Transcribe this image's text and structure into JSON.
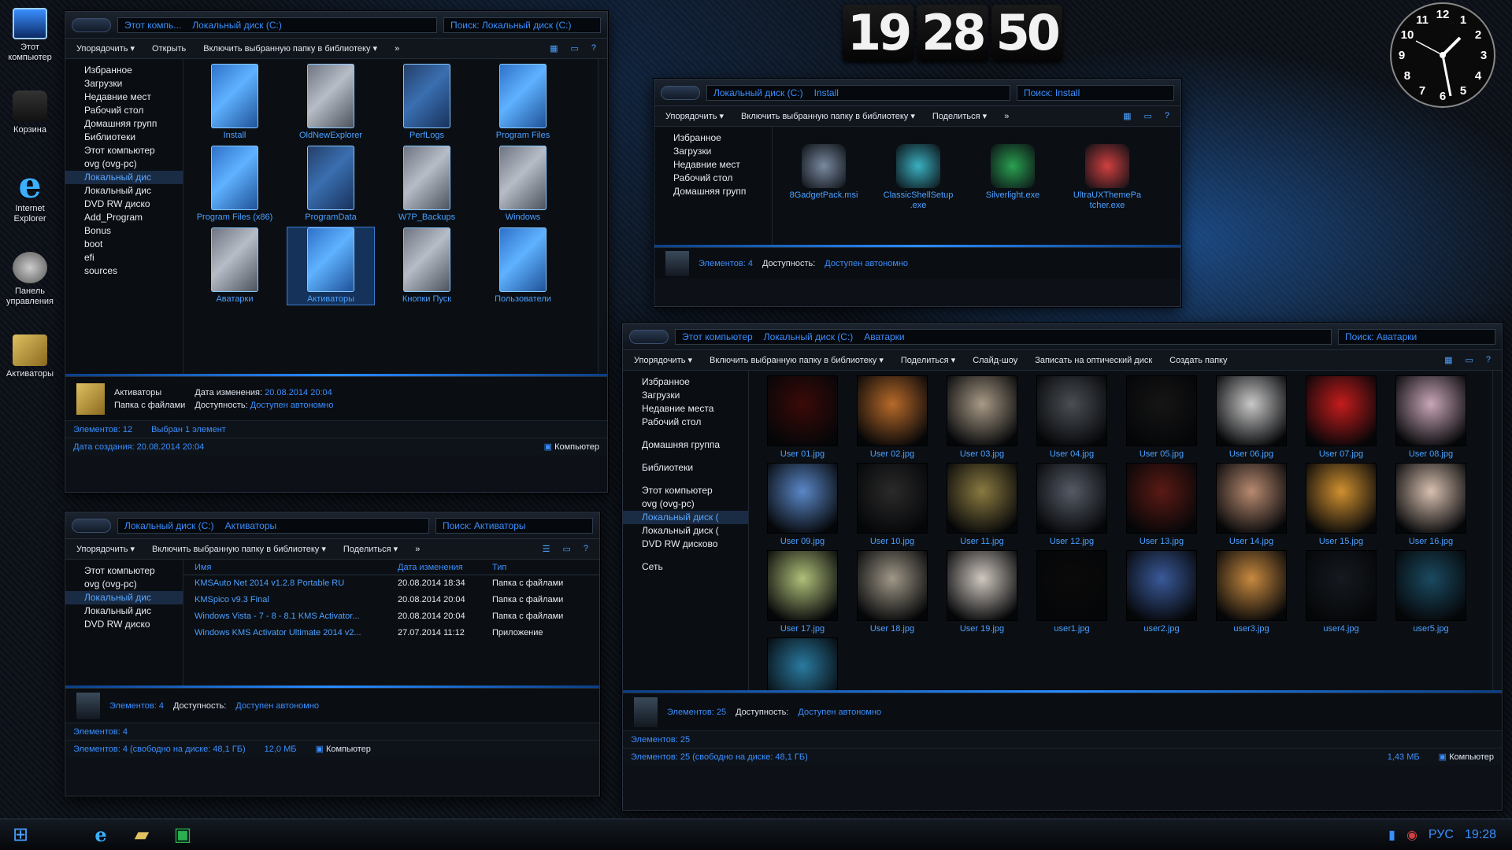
{
  "desktop": {
    "icons": [
      {
        "label": "Этот компьютер"
      },
      {
        "label": "Корзина"
      },
      {
        "label": "Internet Explorer"
      },
      {
        "label": "Панель управления"
      },
      {
        "label": "Активаторы"
      }
    ]
  },
  "clock": {
    "h": "19",
    "m": "28",
    "s": "50"
  },
  "analog": {
    "numbers": [
      "12",
      "1",
      "2",
      "3",
      "4",
      "5",
      "6",
      "7",
      "8",
      "9",
      "10",
      "11"
    ]
  },
  "w1": {
    "address": [
      "Этот компь...",
      "Локальный диск (C:)"
    ],
    "search": "Поиск: Локальный диск (C:)",
    "toolbar": [
      "Упорядочить ▾",
      "Открыть",
      "Включить выбранную папку в библиотеку ▾",
      "»"
    ],
    "nav": [
      "Избранное",
      "Загрузки",
      "Недавние мест",
      "Рабочий стол",
      "Домашняя групп",
      "Библиотеки",
      "Этот компьютер",
      "ovg (ovg-pc)",
      "Локальный дис",
      "Локальный дис",
      "DVD RW диско",
      "Add_Program",
      "Bonus",
      "boot",
      "efi",
      "sources"
    ],
    "folders": [
      {
        "name": "Install"
      },
      {
        "name": "OldNewExplorer"
      },
      {
        "name": "PerfLogs"
      },
      {
        "name": "Program Files"
      },
      {
        "name": "Program Files (x86)"
      },
      {
        "name": "ProgramData"
      },
      {
        "name": "W7P_Backups"
      },
      {
        "name": "Windows"
      },
      {
        "name": "Аватарки"
      },
      {
        "name": "Активаторы"
      },
      {
        "name": "Кнопки Пуск"
      },
      {
        "name": "Пользователи"
      }
    ],
    "detail": {
      "name": "Активаторы",
      "type": "Папка с файлами",
      "date_label": "Дата изменения:",
      "date": "20.08.2014 20:04",
      "access_label": "Доступность:",
      "access": "Доступен автономно"
    },
    "status": {
      "count": "Элементов: 12",
      "selected": "Выбран 1 элемент"
    },
    "status2": {
      "created": "Дата создания: 20.08.2014 20:04",
      "computer": "Компьютер"
    }
  },
  "w2": {
    "address": [
      "Локальный диск (C:)",
      "Install"
    ],
    "search": "Поиск: Install",
    "toolbar": [
      "Упорядочить ▾",
      "Включить выбранную папку в библиотеку ▾",
      "Поделиться ▾",
      "»"
    ],
    "nav": [
      "Избранное",
      "Загрузки",
      "Недавние мест",
      "Рабочий стол",
      "Домашняя групп"
    ],
    "files": [
      {
        "name": "8GadgetPack.msi"
      },
      {
        "name": "ClassicShellSetup .exe"
      },
      {
        "name": "Silverlight.exe"
      },
      {
        "name": "UltraUXThemePa tcher.exe"
      }
    ],
    "detail": {
      "count": "Элементов: 4",
      "access_label": "Доступность:",
      "access": "Доступен автономно"
    }
  },
  "w3": {
    "address": [
      "Локальный диск (C:)",
      "Активаторы"
    ],
    "search": "Поиск: Активаторы",
    "toolbar": [
      "Упорядочить ▾",
      "Включить выбранную папку в библиотеку ▾",
      "Поделиться ▾",
      "»"
    ],
    "nav": [
      "Этот компьютер",
      "ovg (ovg-pc)",
      "Локальный дис",
      "Локальный дис",
      "DVD RW диско"
    ],
    "cols": [
      "Имя",
      "Дата изменения",
      "Тип"
    ],
    "rows": [
      {
        "n": "KMSAuto Net 2014 v1.2.8 Portable RU",
        "d": "20.08.2014 18:34",
        "t": "Папка с файлами"
      },
      {
        "n": "KMSpico v9.3 Final",
        "d": "20.08.2014 20:04",
        "t": "Папка с файлами"
      },
      {
        "n": "Windows Vista - 7 - 8 - 8.1 KMS Activator...",
        "d": "20.08.2014 20:04",
        "t": "Папка с файлами"
      },
      {
        "n": "Windows KMS Activator Ultimate 2014 v2...",
        "d": "27.07.2014 11:12",
        "t": "Приложение"
      }
    ],
    "detail": {
      "count": "Элементов: 4",
      "access_label": "Доступность:",
      "access": "Доступен автономно"
    },
    "status": {
      "count": "Элементов: 4"
    },
    "status2": {
      "free": "Элементов: 4 (свободно на диске: 48,1 ГБ)",
      "size": "12,0 МБ",
      "computer": "Компьютер"
    }
  },
  "w4": {
    "address": [
      "Этот компьютер",
      "Локальный диск (C:)",
      "Аватарки"
    ],
    "search": "Поиск: Аватарки",
    "toolbar": [
      "Упорядочить ▾",
      "Включить выбранную папку в библиотеку ▾",
      "Поделиться ▾",
      "Слайд-шоу",
      "Записать на оптический диск",
      "Создать папку"
    ],
    "nav": [
      "Избранное",
      "Загрузки",
      "Недавние места",
      "Рабочий стол",
      "",
      "Домашняя группа",
      "",
      "Библиотеки",
      "",
      "Этот компьютер",
      "ovg (ovg-pc)",
      "Локальный диск (",
      "Локальный диск (",
      "DVD RW дисково",
      "",
      "Сеть"
    ],
    "images": [
      {
        "name": "User 01.jpg",
        "color": "#3a0a08"
      },
      {
        "name": "User 02.jpg",
        "color": "#b86a2a"
      },
      {
        "name": "User 03.jpg",
        "color": "#a89a86"
      },
      {
        "name": "User 04.jpg",
        "color": "#4a4f55"
      },
      {
        "name": "User 05.jpg",
        "color": "#151515"
      },
      {
        "name": "User 06.jpg",
        "color": "#c9c9c9"
      },
      {
        "name": "User 07.jpg",
        "color": "#c41c1c"
      },
      {
        "name": "User 08.jpg",
        "color": "#c9a6b8"
      },
      {
        "name": "User 09.jpg",
        "color": "#5a88c8"
      },
      {
        "name": "User 10.jpg",
        "color": "#2a2a2a"
      },
      {
        "name": "User 11.jpg",
        "color": "#8a7a40"
      },
      {
        "name": "User 12.jpg",
        "color": "#555b66"
      },
      {
        "name": "User 13.jpg",
        "color": "#5a1a14"
      },
      {
        "name": "User 14.jpg",
        "color": "#b88a70"
      },
      {
        "name": "User 15.jpg",
        "color": "#d09030"
      },
      {
        "name": "User 16.jpg",
        "color": "#d8c0b0"
      },
      {
        "name": "User 17.jpg",
        "color": "#b0c07a"
      },
      {
        "name": "User 18.jpg",
        "color": "#a09888"
      },
      {
        "name": "User 19.jpg",
        "color": "#d0c8c0"
      },
      {
        "name": "user1.jpg",
        "color": "#0a0a0a"
      },
      {
        "name": "user2.jpg",
        "color": "#3a5a9a"
      },
      {
        "name": "user3.jpg",
        "color": "#c88a40"
      },
      {
        "name": "user4.jpg",
        "color": "#151a20"
      },
      {
        "name": "user5.jpg",
        "color": "#1a4a60"
      },
      {
        "name": "",
        "color": "#2a7aa0"
      }
    ],
    "detail": {
      "count": "Элементов: 25",
      "access_label": "Доступность:",
      "access": "Доступен автономно"
    },
    "status": {
      "count": "Элементов: 25"
    },
    "status2": {
      "free": "Элементов: 25 (свободно на диске: 48,1 ГБ)",
      "size": "1,43 МБ",
      "computer": "Компьютер"
    }
  },
  "taskbar": {
    "lang": "РУС",
    "time": "19:28"
  }
}
